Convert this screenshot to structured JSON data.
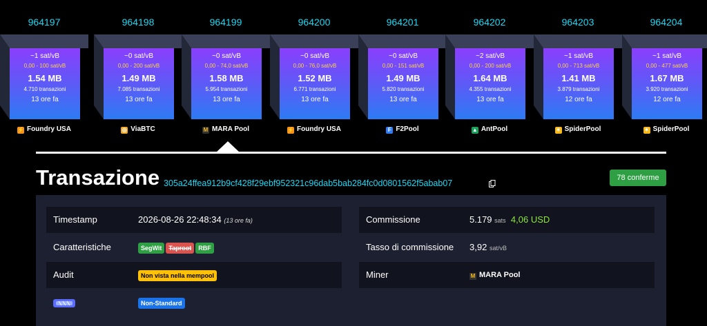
{
  "blocks": [
    {
      "height": "964197",
      "fee": "~1 sat/vB",
      "range": "0,00 - 100 sat/vB",
      "size": "1.54 MB",
      "tx": "4.710 transazioni",
      "age": "13 ore fa",
      "pool": "Foundry USA",
      "pool_icon": "foundry-icon",
      "icon_color": "#f7931a"
    },
    {
      "height": "964198",
      "fee": "~0 sat/vB",
      "range": "0,00 - 200 sat/vB",
      "size": "1.49 MB",
      "tx": "7.085 transazioni",
      "age": "13 ore fa",
      "pool": "ViaBTC",
      "pool_icon": "viabtc-icon",
      "icon_color": "#f5a623"
    },
    {
      "height": "964199",
      "fee": "~0 sat/vB",
      "range": "0,00 - 74,0 sat/vB",
      "size": "1.58 MB",
      "tx": "5.954 transazioni",
      "age": "13 ore fa",
      "pool": "MARA Pool",
      "pool_icon": "mara-icon",
      "icon_color": "#333333"
    },
    {
      "height": "964200",
      "fee": "~0 sat/vB",
      "range": "0,00 - 76,0 sat/vB",
      "size": "1.52 MB",
      "tx": "6.771 transazioni",
      "age": "13 ore fa",
      "pool": "Foundry USA",
      "pool_icon": "foundry-icon",
      "icon_color": "#f7931a"
    },
    {
      "height": "964201",
      "fee": "~0 sat/vB",
      "range": "0,00 - 151 sat/vB",
      "size": "1.49 MB",
      "tx": "5.820 transazioni",
      "age": "13 ore fa",
      "pool": "F2Pool",
      "pool_icon": "f2pool-icon",
      "icon_color": "#2f7cf6"
    },
    {
      "height": "964202",
      "fee": "~2 sat/vB",
      "range": "0,00 - 200 sat/vB",
      "size": "1.64 MB",
      "tx": "4.355 transazioni",
      "age": "13 ore fa",
      "pool": "AntPool",
      "pool_icon": "antpool-icon",
      "icon_color": "#19a05b"
    },
    {
      "height": "964203",
      "fee": "~1 sat/vB",
      "range": "0,00 - 713 sat/vB",
      "size": "1.41 MB",
      "tx": "3.879 transazioni",
      "age": "12 ore fa",
      "pool": "SpiderPool",
      "pool_icon": "spiderpool-icon",
      "icon_color": "#f7b91a"
    },
    {
      "height": "964204",
      "fee": "~1 sat/vB",
      "range": "0,00 - 477 sat/vB",
      "size": "1.67 MB",
      "tx": "3.920 transazioni",
      "age": "12 ore fa",
      "pool": "SpiderPool",
      "pool_icon": "spiderpool-icon",
      "icon_color": "#f7b91a"
    }
  ],
  "tx": {
    "title": "Transazione",
    "txid": "305a24ffea912b9cf428f29ebf952321c96dab5bab284fc0d0801562f5abab07",
    "confirmations": "78 conferme"
  },
  "details": {
    "timestamp_label": "Timestamp",
    "timestamp_value": "2026-08-26 22:48:34",
    "timestamp_ago": "(13 ore fa)",
    "features_label": "Caratteristiche",
    "features": [
      "SegWit",
      "Taproot",
      "RBF"
    ],
    "audit_label": "Audit",
    "audit_value": "Non vista nella mempool",
    "nonstandard": "Non-Standard",
    "fee_label": "Commissione",
    "fee_sats": "5.179",
    "fee_sats_unit": "sats",
    "fee_usd": "4,06 USD",
    "feerate_label": "Tasso di commissione",
    "feerate_value": "3,92",
    "feerate_unit": "sat/vB",
    "miner_label": "Miner",
    "miner_value": "MARA Pool"
  },
  "colors": {
    "accent": "#1bd8f4",
    "green": "#2ea043",
    "usd": "#8ee63b",
    "taproot": "#d9534f",
    "audit": "#ffc107",
    "nonstandard": "#1a73e8"
  }
}
